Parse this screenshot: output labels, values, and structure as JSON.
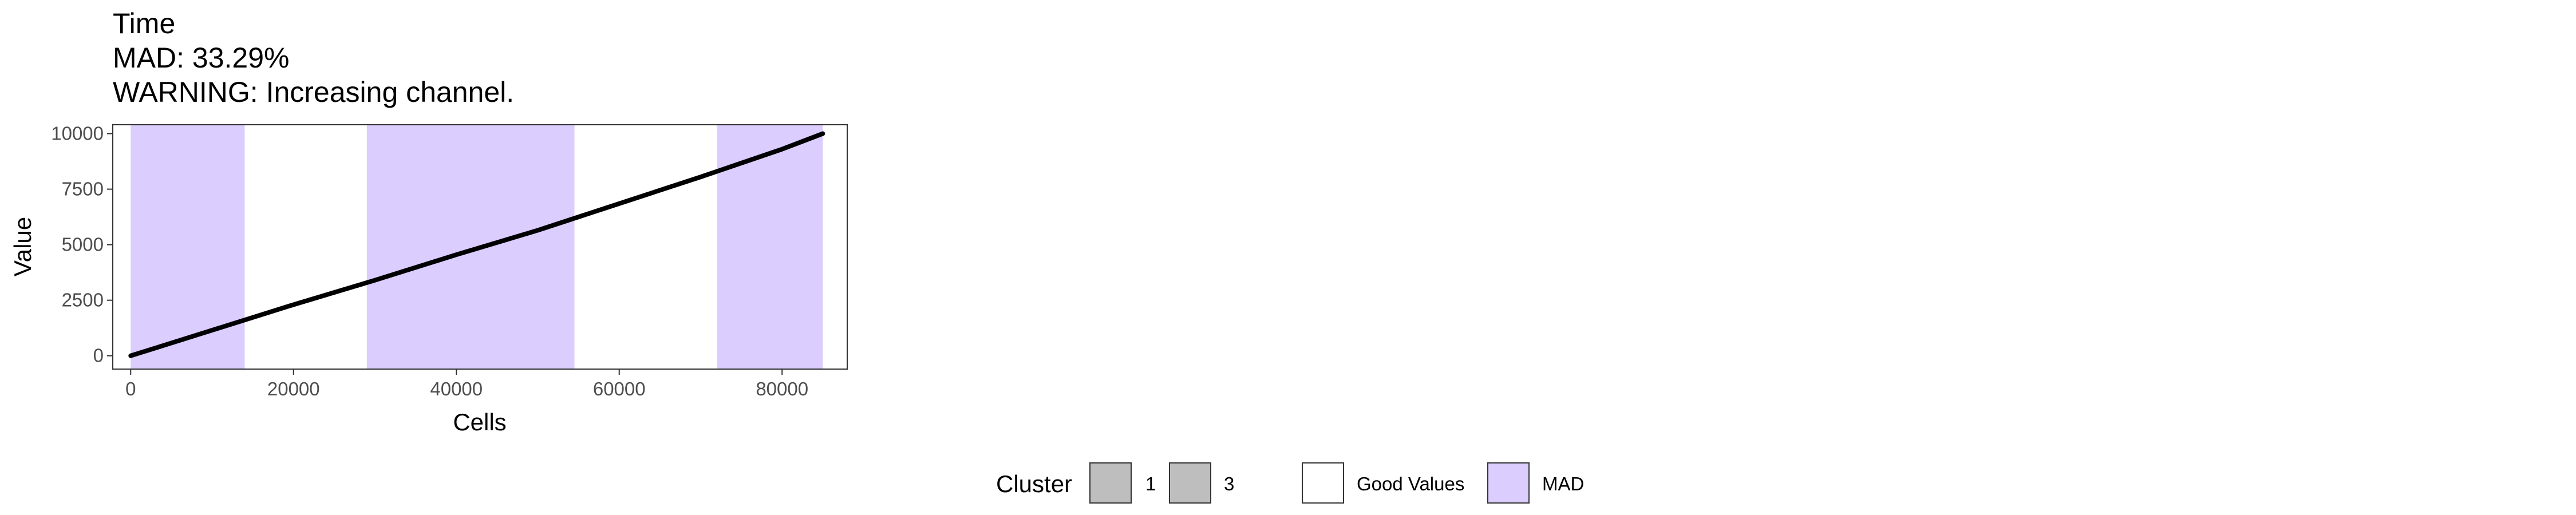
{
  "chart_data": {
    "type": "line",
    "title": "Time",
    "subtitle_lines": [
      "MAD: 33.29%",
      "WARNING: Increasing channel."
    ],
    "xlabel": "Cells",
    "ylabel": "Value",
    "xlim": [
      -2200,
      88000
    ],
    "ylim": [
      -600,
      10400
    ],
    "x_ticks": [
      0,
      20000,
      40000,
      60000,
      80000
    ],
    "x_tick_labels": [
      "0",
      "20000",
      "40000",
      "60000",
      "80000"
    ],
    "y_ticks": [
      0,
      2500,
      5000,
      7500,
      10000
    ],
    "y_tick_labels": [
      "0",
      "2500",
      "5000",
      "7500",
      "10000"
    ],
    "grid": false,
    "series": [
      {
        "color": "#000000",
        "x": [
          0,
          10000,
          20000,
          30000,
          40000,
          50000,
          60000,
          70000,
          80000,
          85000
        ],
        "y": [
          0,
          1150,
          2300,
          3400,
          4550,
          5650,
          6850,
          8050,
          9300,
          10000
        ]
      }
    ],
    "shaded_regions": [
      {
        "x_start": 0,
        "x_end": 14000,
        "category": "MAD",
        "color": "#dccdff"
      },
      {
        "x_start": 29000,
        "x_end": 54500,
        "category": "MAD",
        "color": "#dccdff"
      },
      {
        "x_start": 72000,
        "x_end": 85000,
        "category": "MAD",
        "color": "#dccdff"
      }
    ],
    "legend": {
      "position": "bottom",
      "title": "Cluster",
      "items": [
        {
          "label": "1",
          "color": "#bebebe"
        },
        {
          "label": "3",
          "color": "#bebebe"
        },
        {
          "label": "Good Values",
          "color": "#ffffff"
        },
        {
          "label": "MAD",
          "color": "#dccdff"
        }
      ]
    }
  }
}
